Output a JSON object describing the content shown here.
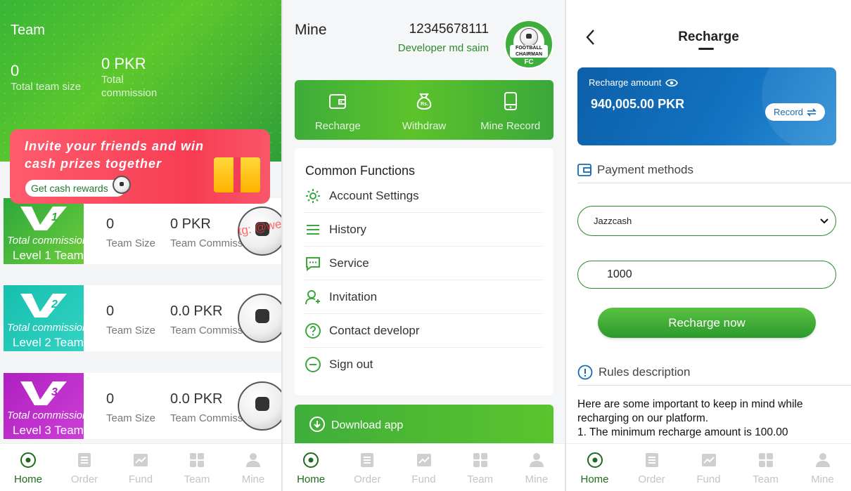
{
  "colors": {
    "brand_green": "#3aaa35",
    "tab_active": "#1e6b1e",
    "invite_red": "#f73d53",
    "recharge_blue": "#1269b8"
  },
  "tabbar": [
    {
      "label": "Home",
      "icon": "soccer-ball-icon"
    },
    {
      "label": "Order",
      "icon": "list-icon"
    },
    {
      "label": "Fund",
      "icon": "chart-icon"
    },
    {
      "label": "Team",
      "icon": "grid-icon"
    },
    {
      "label": "Mine",
      "icon": "user-icon"
    }
  ],
  "team": {
    "title": "Team",
    "team_size_value": "0",
    "team_size_label": "Total team size",
    "commission_value": "0 PKR",
    "commission_label_1": "Total",
    "commission_label_2": "commission",
    "invite": {
      "text_1": "Invite your friends and win",
      "text_2": "cash prizes together",
      "button": "Get cash rewards"
    },
    "watermark": "tg: @welunt",
    "levels": [
      {
        "badge_num": "1",
        "total_italic": "Total",
        "total_rest": " commission",
        "level_label": "Level 1 Team",
        "size": "0",
        "size_label": "Team Size",
        "commission": "0 PKR",
        "commission_label": "Team Commission"
      },
      {
        "badge_num": "2",
        "total_italic": "Total",
        "total_rest": " commission",
        "level_label": "Level 2 Team",
        "size": "0",
        "size_label": "Team Size",
        "commission": "0.0 PKR",
        "commission_label": "Team Commission"
      },
      {
        "badge_num": "3",
        "total_italic": "Total",
        "total_rest": " commission",
        "level_label": "Level 3 Team",
        "size": "0",
        "size_label": "Team Size",
        "commission": "0.0 PKR",
        "commission_label": "Team Commission"
      }
    ]
  },
  "mine": {
    "title": "Mine",
    "user_id": "12345678111",
    "user_name": "Developer md saim",
    "logo": {
      "line1": "FOOTBALL",
      "line2": "CHAIRMAN",
      "line3": "FC"
    },
    "actions": [
      {
        "label": "Recharge",
        "icon": "wallet-icon"
      },
      {
        "label": "Withdraw",
        "icon": "money-bag-icon"
      },
      {
        "label": "Mine Record",
        "icon": "phone-icon"
      }
    ],
    "common_title": "Common Functions",
    "functions": [
      {
        "label": "Account Settings",
        "icon": "gear-icon"
      },
      {
        "label": "History",
        "icon": "list-lines-icon"
      },
      {
        "label": "Service",
        "icon": "chat-icon"
      },
      {
        "label": "Invitation",
        "icon": "add-user-icon"
      },
      {
        "label": "Contact developr",
        "icon": "question-icon"
      },
      {
        "label": "Sign out",
        "icon": "minus-circle-icon"
      }
    ],
    "download": "Download app"
  },
  "recharge": {
    "title": "Recharge",
    "amount_label": "Recharge amount",
    "amount_value": "940,005.00 PKR",
    "record_button": "Record",
    "payment_methods": "Payment methods",
    "selected_method": "Jazzcash",
    "amount_input": "1000",
    "submit": "Recharge now",
    "rules_title": "Rules description",
    "rules_line_1": "Here are some important to keep in mind while recharging on our platform.",
    "rules_line_2": "1. The minimum recharge amount is 100.00"
  }
}
